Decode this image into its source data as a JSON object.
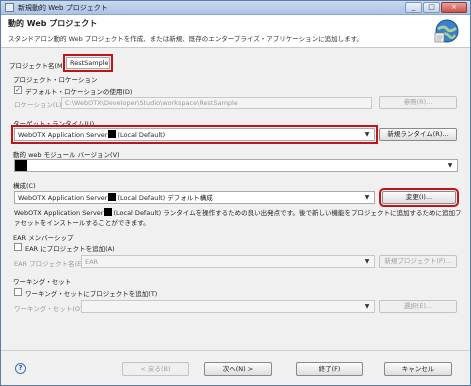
{
  "window": {
    "title": "新規動的 Web プロジェクト",
    "controls": [
      "_",
      "□",
      "×"
    ]
  },
  "header": {
    "title": "動的 Web プロジェクト",
    "description": "スタンドアロン動的 Web プロジェクトを作成、または新規、既存のエンタープライズ・アプリケーションに追加します。"
  },
  "project_name": {
    "label": "プロジェクト名(M):",
    "value": "RestSample"
  },
  "location": {
    "group_label": "プロジェクト・ロケーション",
    "default_checkbox_label": "デフォルト・ロケーションの使用(D)",
    "location_label": "ロケーション(L):",
    "location_value": "C:\\WebOTX\\Developer\\Studio\\workspace\\RestSample",
    "browse_label": "参照(R)..."
  },
  "target_runtime": {
    "label": "ターゲット・ランタイム(U)",
    "value_prefix": "WebOTX Application Server",
    "value_suffix": "(Local Default)",
    "new_runtime_label": "新規ランタイム(R)..."
  },
  "module_version": {
    "label": "動的 web モジュール バージョン(V)"
  },
  "configuration": {
    "label": "構成(C)",
    "value_prefix": "WebOTX Application Server",
    "value_suffix": "(Local Default) デフォルト構成",
    "modify_label": "変更(I)...",
    "description_prefix": "WebOTX Application Server",
    "description_suffix": "(Local Default) ランタイムを操作するための良い出発点です。後で新しい機能をプロジェクトに追加するために追加ファセットをインストールすることができます。"
  },
  "ear": {
    "group_label": "EAR メンバーシップ",
    "add_checkbox_label": "EAR にプロジェクトを追加(A)",
    "project_name_label": "EAR プロジェクト名(E):",
    "project_name_value": "EAR",
    "new_project_label": "新規プロジェクト(P)..."
  },
  "working_set": {
    "group_label": "ワーキング・セット",
    "add_checkbox_label": "ワーキング・セットにプロジェクトを追加(T)",
    "working_set_label": "ワーキング・セット(O):",
    "select_label": "選択(E)..."
  },
  "footer": {
    "back_label": "< 戻る(B)",
    "next_label": "次へ(N) >",
    "finish_label": "終了(F)",
    "cancel_label": "キャンセル"
  },
  "colors": {
    "highlight": "#c0141b",
    "title_bar": "#a9c3e6"
  }
}
